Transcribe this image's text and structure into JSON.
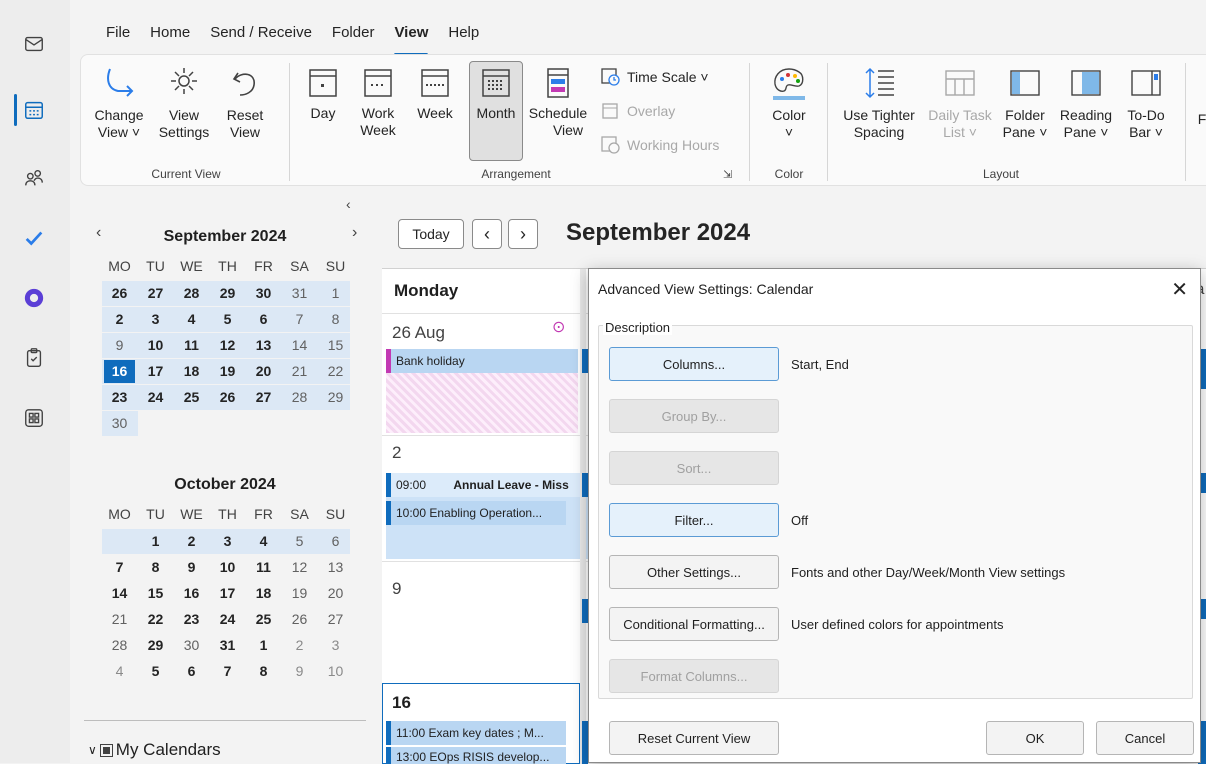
{
  "menu": {
    "tabs": [
      "File",
      "Home",
      "Send / Receive",
      "Folder",
      "View",
      "Help"
    ],
    "active": "View"
  },
  "ribbon": {
    "change_view": [
      "Change",
      "View ˅"
    ],
    "view_settings": [
      "View",
      "Settings"
    ],
    "reset_view": [
      "Reset",
      "View"
    ],
    "current_view_label": "Current View",
    "day": "Day",
    "work_week": [
      "Work",
      "Week"
    ],
    "week": "Week",
    "month": "Month",
    "schedule_view": [
      "Schedule",
      "View"
    ],
    "time_scale": "Time Scale ˅",
    "overlay": "Overlay",
    "working_hours": "Working Hours",
    "arrangement_label": "Arrangement",
    "color": [
      "Color",
      "˅"
    ],
    "color_label": "Color",
    "tighter_spacing": [
      "Use Tighter",
      "Spacing"
    ],
    "daily_task_list": [
      "Daily Task",
      "List ˅"
    ],
    "folder_pane": [
      "Folder",
      "Pane ˅"
    ],
    "reading_pane": [
      "Reading",
      "Pane ˅"
    ],
    "todo_bar": [
      "To-Do",
      "Bar ˅"
    ],
    "layout_label": "Layout",
    "cut_off": "F"
  },
  "navpane": {
    "sep_title": "September 2024",
    "oct_title": "October 2024",
    "dow": [
      "MO",
      "TU",
      "WE",
      "TH",
      "FR",
      "SA",
      "SU"
    ],
    "sep_weeks": [
      [
        "26",
        "27",
        "28",
        "29",
        "30",
        "31",
        "1"
      ],
      [
        "2",
        "3",
        "4",
        "5",
        "6",
        "7",
        "8"
      ],
      [
        "9",
        "10",
        "11",
        "12",
        "13",
        "14",
        "15"
      ],
      [
        "16",
        "17",
        "18",
        "19",
        "20",
        "21",
        "22"
      ],
      [
        "23",
        "24",
        "25",
        "26",
        "27",
        "28",
        "29"
      ],
      [
        "30"
      ]
    ],
    "oct_weeks": [
      [
        "",
        "1",
        "2",
        "3",
        "4",
        "5",
        "6"
      ],
      [
        "7",
        "8",
        "9",
        "10",
        "11",
        "12",
        "13"
      ],
      [
        "14",
        "15",
        "16",
        "17",
        "18",
        "19",
        "20"
      ],
      [
        "21",
        "22",
        "23",
        "24",
        "25",
        "26",
        "27"
      ],
      [
        "28",
        "29",
        "30",
        "31",
        "1",
        "2",
        "3"
      ],
      [
        "4",
        "5",
        "6",
        "7",
        "8",
        "9",
        "10"
      ]
    ],
    "today": "16",
    "my_calendars": "My Calendars"
  },
  "calendar": {
    "today_button": "Today",
    "title": "September 2024",
    "column_header": "Monday",
    "cells": [
      "26 Aug",
      "2",
      "9",
      "16"
    ],
    "events": [
      "Bank holiday",
      "09:00",
      "Annual Leave - Miss",
      "10:00 Enabling Operation...",
      "11:00 Exam key dates ; M...",
      "13:00 EOps RISIS develop..."
    ],
    "cut_off": "la"
  },
  "dialog": {
    "title": "Advanced View Settings: Calendar",
    "section": "Description",
    "rows": [
      {
        "button": "Columns...",
        "value": "Start, End",
        "state": "focused"
      },
      {
        "button": "Group By...",
        "value": "",
        "state": "disabled"
      },
      {
        "button": "Sort...",
        "value": "",
        "state": "disabled"
      },
      {
        "button": "Filter...",
        "value": "Off",
        "state": "hover"
      },
      {
        "button": "Other Settings...",
        "value": "Fonts and other Day/Week/Month View settings",
        "state": "normal"
      },
      {
        "button": "Conditional Formatting...",
        "value": "User defined colors for appointments",
        "state": "normal"
      },
      {
        "button": "Format Columns...",
        "value": "",
        "state": "disabled"
      }
    ],
    "reset": "Reset Current View",
    "ok": "OK",
    "cancel": "Cancel"
  },
  "colors": {
    "accent": "#0f6cbd",
    "selection": "#dce8f5",
    "event": "#b9d6f2"
  }
}
